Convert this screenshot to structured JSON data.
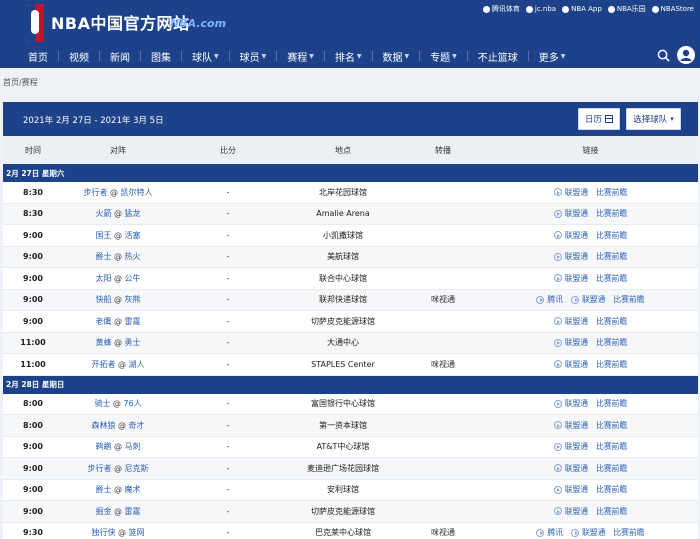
{
  "site": {
    "title": "NBA中国官方网站",
    "domain": "NBA.com",
    "partners": [
      "腾讯体育",
      "jc.nba",
      "NBA App",
      "NBA乐园",
      "NBAStore"
    ]
  },
  "nav": {
    "items": [
      {
        "label": "首页",
        "dropdown": false
      },
      {
        "label": "视频",
        "dropdown": false
      },
      {
        "label": "新闻",
        "dropdown": false
      },
      {
        "label": "图集",
        "dropdown": false
      },
      {
        "label": "球队",
        "dropdown": true
      },
      {
        "label": "球员",
        "dropdown": true
      },
      {
        "label": "赛程",
        "dropdown": true
      },
      {
        "label": "排名",
        "dropdown": true
      },
      {
        "label": "数据",
        "dropdown": true
      },
      {
        "label": "专题",
        "dropdown": true
      },
      {
        "label": "不止篮球",
        "dropdown": false
      },
      {
        "label": "更多",
        "dropdown": true
      }
    ]
  },
  "breadcrumb": {
    "home": "首页",
    "sep": "/",
    "current": "赛程"
  },
  "schedule": {
    "date_range": "2021年 2月 27日 - 2021年 3月 5日",
    "calendar_btn": "日历",
    "team_btn": "选择球队",
    "columns": [
      "时间",
      "对阵",
      "比分",
      "地点",
      "转播",
      "链接"
    ],
    "days": [
      {
        "label": "2月 27日 星期六",
        "games": [
          {
            "time": "8:30",
            "away": "步行者",
            "home": "凯尔特人",
            "score": "-",
            "venue": "北岸花园球馆",
            "tv": "",
            "links": [
              "联盟通",
              "比赛前瞻"
            ]
          },
          {
            "time": "8:30",
            "away": "火箭",
            "home": "猛龙",
            "score": "-",
            "venue": "Amalie Arena",
            "tv": "",
            "links": [
              "联盟通",
              "比赛前瞻"
            ]
          },
          {
            "time": "9:00",
            "away": "国王",
            "home": "活塞",
            "score": "-",
            "venue": "小凯撒球馆",
            "tv": "",
            "links": [
              "联盟通",
              "比赛前瞻"
            ]
          },
          {
            "time": "9:00",
            "away": "爵士",
            "home": "热火",
            "score": "-",
            "venue": "美航球馆",
            "tv": "",
            "links": [
              "联盟通",
              "比赛前瞻"
            ]
          },
          {
            "time": "9:00",
            "away": "太阳",
            "home": "公牛",
            "score": "-",
            "venue": "联合中心球馆",
            "tv": "",
            "links": [
              "联盟通",
              "比赛前瞻"
            ]
          },
          {
            "time": "9:00",
            "away": "快船",
            "home": "灰熊",
            "score": "-",
            "venue": "联邦快递球馆",
            "tv": "咪视通",
            "links": [
              "腾讯",
              "联盟通",
              "比赛前瞻"
            ]
          },
          {
            "time": "9:00",
            "away": "老鹰",
            "home": "雷霆",
            "score": "-",
            "venue": "切萨皮克能源球馆",
            "tv": "",
            "links": [
              "联盟通",
              "比赛前瞻"
            ]
          },
          {
            "time": "11:00",
            "away": "黄蜂",
            "home": "勇士",
            "score": "-",
            "venue": "大通中心",
            "tv": "",
            "links": [
              "联盟通",
              "比赛前瞻"
            ]
          },
          {
            "time": "11:00",
            "away": "开拓者",
            "home": "湖人",
            "score": "-",
            "venue": "STAPLES Center",
            "tv": "咪视通",
            "links": [
              "联盟通",
              "比赛前瞻"
            ]
          }
        ]
      },
      {
        "label": "2月 28日 星期日",
        "games": [
          {
            "time": "8:00",
            "away": "骑士",
            "home": "76人",
            "score": "-",
            "venue": "富国银行中心球馆",
            "tv": "",
            "links": [
              "联盟通",
              "比赛前瞻"
            ]
          },
          {
            "time": "8:00",
            "away": "森林狼",
            "home": "奇才",
            "score": "-",
            "venue": "第一资本球馆",
            "tv": "",
            "links": [
              "联盟通",
              "比赛前瞻"
            ]
          },
          {
            "time": "9:00",
            "away": "鹈鹕",
            "home": "马刺",
            "score": "-",
            "venue": "AT&T中心球馆",
            "tv": "",
            "links": [
              "联盟通",
              "比赛前瞻"
            ]
          },
          {
            "time": "9:00",
            "away": "步行者",
            "home": "尼克斯",
            "score": "-",
            "venue": "麦迪逊广场花园球馆",
            "tv": "",
            "links": [
              "联盟通",
              "比赛前瞻"
            ]
          },
          {
            "time": "9:00",
            "away": "爵士",
            "home": "魔术",
            "score": "-",
            "venue": "安利球馆",
            "tv": "",
            "links": [
              "联盟通",
              "比赛前瞻"
            ]
          },
          {
            "time": "9:00",
            "away": "掘金",
            "home": "雷霆",
            "score": "-",
            "venue": "切萨皮克能源球馆",
            "tv": "",
            "links": [
              "联盟通",
              "比赛前瞻"
            ]
          },
          {
            "time": "9:30",
            "away": "独行侠",
            "home": "篮网",
            "score": "-",
            "venue": "巴克莱中心球馆",
            "tv": "咪视通",
            "links": [
              "腾讯",
              "联盟通",
              "比赛前瞻"
            ]
          }
        ]
      }
    ]
  },
  "colors": {
    "brand_blue": "#1d428a",
    "link_blue": "#2b5fb4",
    "red": "#c8102e"
  }
}
